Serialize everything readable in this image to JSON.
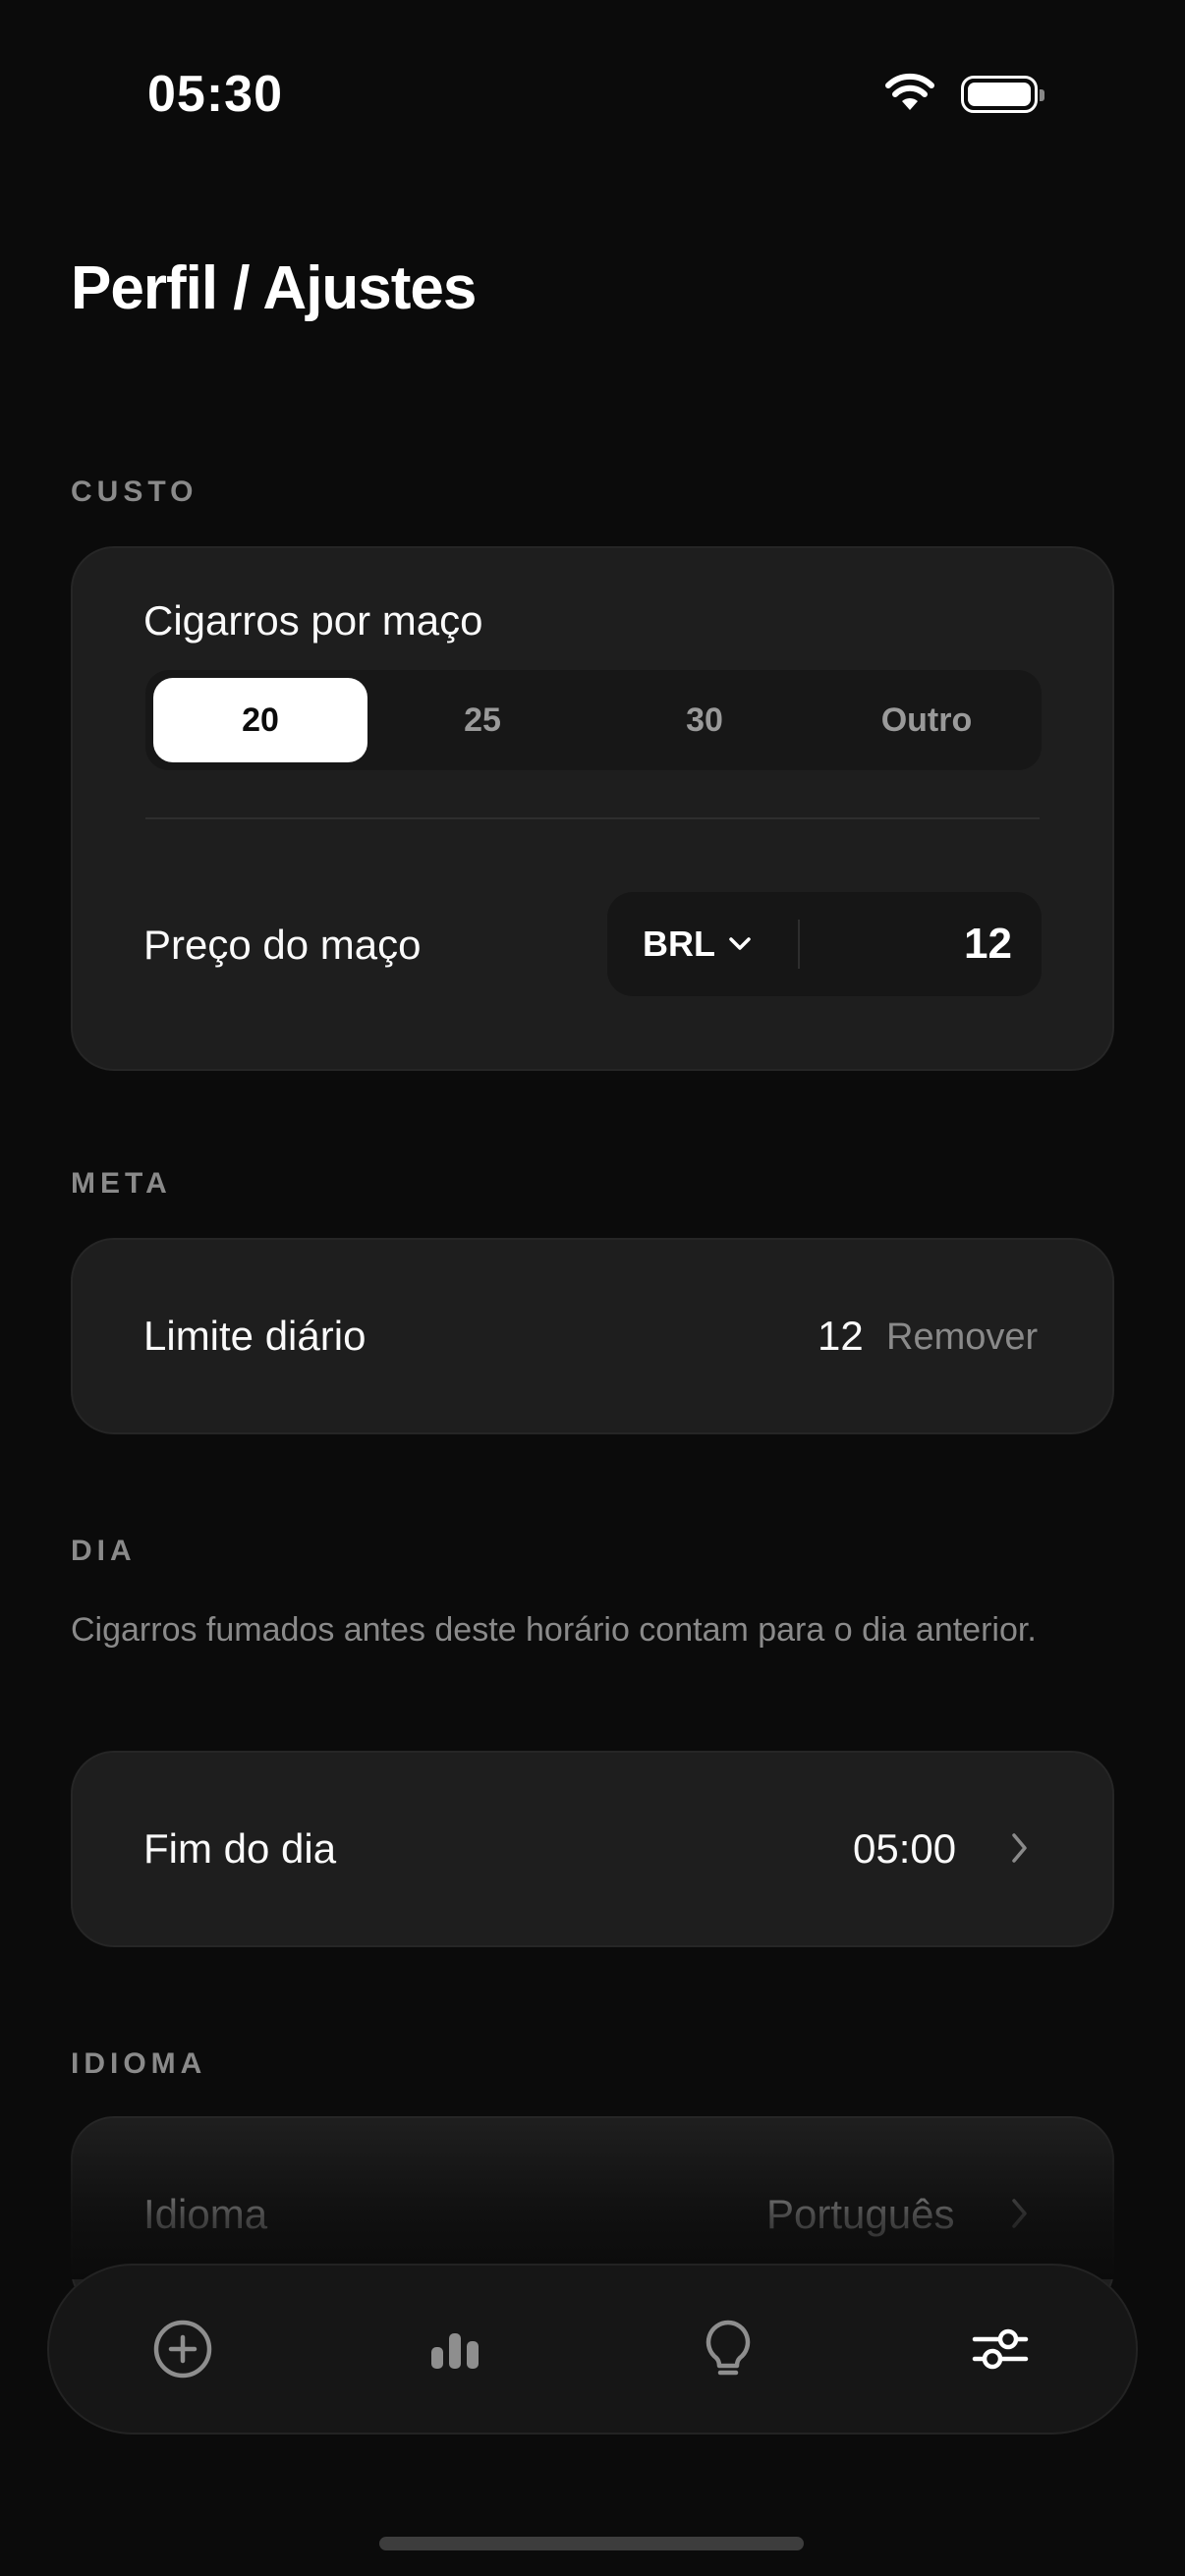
{
  "status": {
    "time": "05:30"
  },
  "page": {
    "title": "Perfil / Ajustes"
  },
  "custo": {
    "section_label": "CUSTO",
    "pack_label": "Cigarros por maço",
    "options": [
      "20",
      "25",
      "30",
      "Outro"
    ],
    "selected_option": "20",
    "price_label": "Preço do maço",
    "currency": "BRL",
    "price_value": "12"
  },
  "meta": {
    "section_label": "META",
    "limit_label": "Limite diário",
    "limit_value": "12",
    "remove_label": "Remover"
  },
  "dia": {
    "section_label": "DIA",
    "helper_text": "Cigarros fumados antes deste horário contam para o dia anterior.",
    "end_label": "Fim do dia",
    "end_value": "05:00"
  },
  "idioma": {
    "section_label": "IDIOMA",
    "label": "Idioma",
    "value": "Português"
  },
  "tabs": [
    {
      "icon": "add-circle-icon"
    },
    {
      "icon": "bar-chart-icon"
    },
    {
      "icon": "lightbulb-icon"
    },
    {
      "icon": "sliders-icon",
      "active": true
    }
  ],
  "colors": {
    "background": "#0b0b0b",
    "card": "#1e1e1e",
    "muted": "#8a8a8a",
    "accent": "#ffffff"
  }
}
